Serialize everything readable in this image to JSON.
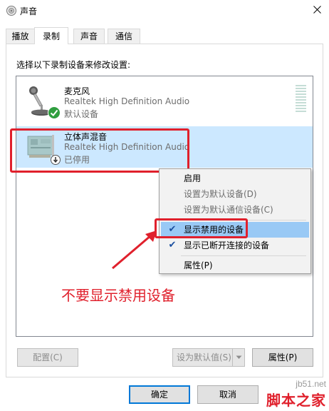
{
  "window": {
    "title": "声音",
    "icon": "speaker-icon"
  },
  "tabs": [
    {
      "label": "播放",
      "active": false
    },
    {
      "label": "录制",
      "active": true
    },
    {
      "label": "声音",
      "active": false
    },
    {
      "label": "通信",
      "active": false
    }
  ],
  "panel": {
    "instruction": "选择以下录制设备来修改设置:"
  },
  "devices": [
    {
      "name": "麦克风",
      "driver": "Realtek High Definition Audio",
      "status": "默认设备",
      "icon": "microphone-icon",
      "badge": "green-check-icon"
    },
    {
      "name": "立体声混音",
      "driver": "Realtek High Definition Audio",
      "status": "已停用",
      "icon": "sound-card-icon",
      "badge": "disabled-arrow-icon"
    }
  ],
  "context_menu": {
    "items": [
      {
        "label": "启用",
        "enabled": true,
        "checked": false
      },
      {
        "label": "设置为默认设备(D)",
        "enabled": false,
        "checked": false
      },
      {
        "label": "设置为默认通信设备(C)",
        "enabled": false,
        "checked": false
      },
      {
        "label": "显示禁用的设备",
        "enabled": true,
        "checked": true,
        "highlighted": true
      },
      {
        "label": "显示已断开连接的设备",
        "enabled": true,
        "checked": true
      },
      {
        "label": "属性(P)",
        "enabled": true,
        "checked": false
      }
    ]
  },
  "annotation": {
    "text": "不要显示禁用设备"
  },
  "buttons": {
    "configure": "配置(C)",
    "set_default": "设为默认值(S)",
    "properties": "属性(P)",
    "ok": "确定",
    "cancel": "取消"
  },
  "watermark": {
    "url": "jb51.net",
    "brand": "脚本之家"
  },
  "colors": {
    "selected_bg": "#cce8ff",
    "highlight_red": "#e0202c",
    "menu_highlight": "#99c9f5",
    "accent": "#0078d7"
  }
}
